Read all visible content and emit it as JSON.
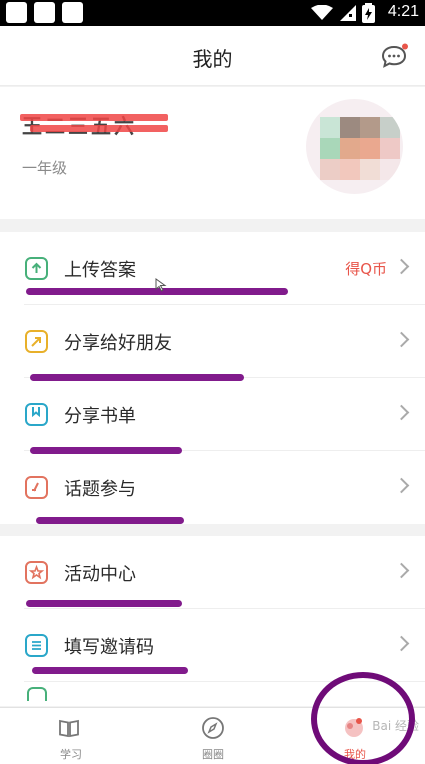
{
  "status_bar": {
    "time": "4:21"
  },
  "header": {
    "title": "我的"
  },
  "profile": {
    "name": "王二三五六",
    "grade": "一年级"
  },
  "menu": {
    "group1": [
      {
        "label": "上传答案",
        "badge": "得Q币",
        "icon": "upload-icon"
      },
      {
        "label": "分享给好朋友",
        "icon": "share-arrow-icon"
      },
      {
        "label": "分享书单",
        "icon": "bookmark-book-icon"
      },
      {
        "label": "话题参与",
        "icon": "topic-edit-icon"
      }
    ],
    "group2": [
      {
        "label": "活动中心",
        "icon": "star-activity-icon"
      },
      {
        "label": "填写邀请码",
        "icon": "invite-code-icon"
      }
    ]
  },
  "tabbar": {
    "tabs": [
      {
        "label": "学习",
        "icon": "book-icon"
      },
      {
        "label": "圈圈",
        "icon": "compass-icon"
      },
      {
        "label": "我的",
        "icon": "profile-icon"
      }
    ]
  },
  "watermark": "Bai 经验",
  "colors": {
    "accent_red": "#e8554a",
    "scribble_purple": "#7a0f86",
    "upload_green": "#47b07a",
    "share_yellow": "#e8b02a",
    "book_teal": "#2aa7c9",
    "topic_red": "#e2735f"
  }
}
